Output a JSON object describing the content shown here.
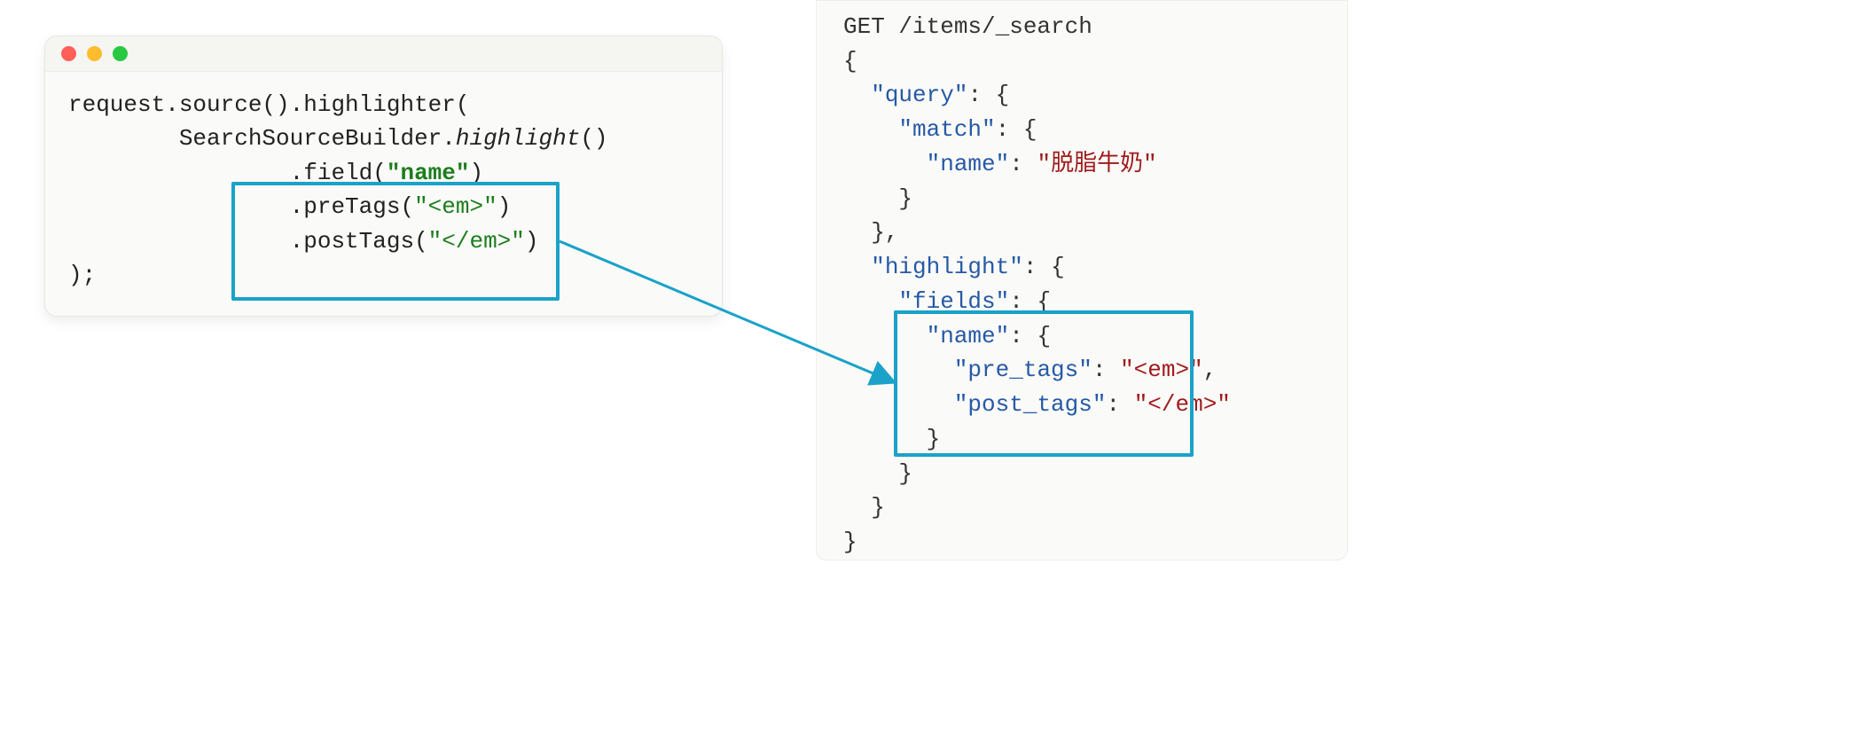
{
  "left": {
    "l1a": "request.source().highlighter(",
    "l2_indent": "        SearchSourceBuilder.",
    "l2_italic": "highlight",
    "l2_tail": "()",
    "l3_indent": "                .field(",
    "l3_str": "\"name\"",
    "l3_tail": ")",
    "l4_indent": "                .preTags(",
    "l4_str": "\"<em>\"",
    "l4_tail": ")",
    "l5_indent": "                .postTags(",
    "l5_str": "\"</em>\"",
    "l5_tail": ")",
    "l6": ");"
  },
  "right": {
    "r1": "GET /items/_search",
    "r2": "{",
    "r3a": "  ",
    "r3k": "\"query\"",
    "r3b": ": {",
    "r4a": "    ",
    "r4k": "\"match\"",
    "r4b": ": {",
    "r5a": "      ",
    "r5k": "\"name\"",
    "r5b": ": ",
    "r5v": "\"脱脂牛奶\"",
    "r6": "    }",
    "r7": "  },",
    "r8a": "  ",
    "r8k": "\"highlight\"",
    "r8b": ": {",
    "r9a": "    ",
    "r9k": "\"fields\"",
    "r9b": ": {",
    "r10a": "      ",
    "r10k": "\"name\"",
    "r10b": ": {",
    "r11a": "        ",
    "r11k": "\"pre_tags\"",
    "r11b": ": ",
    "r11v": "\"<em>\"",
    "r11c": ",",
    "r12a": "        ",
    "r12k": "\"post_tags\"",
    "r12b": ": ",
    "r12v": "\"</em>\"",
    "r13": "      }",
    "r14": "    }",
    "r15": "  }",
    "r16": "}"
  }
}
